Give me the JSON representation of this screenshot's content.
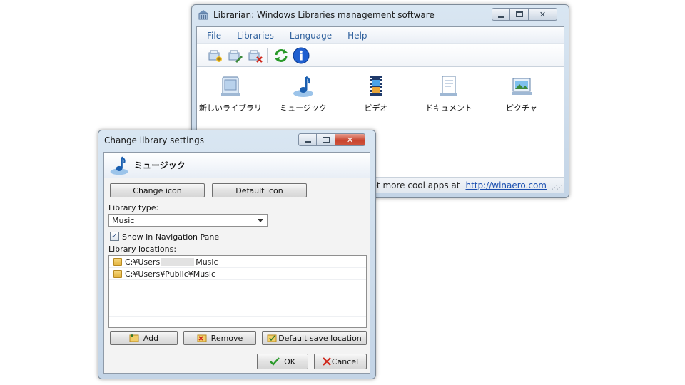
{
  "main_window": {
    "title": "Librarian: Windows Libraries management software",
    "menu": [
      "File",
      "Libraries",
      "Language",
      "Help"
    ],
    "toolbar_icons": [
      "new-library-icon",
      "edit-library-icon",
      "delete-library-icon",
      "refresh-icon",
      "info-icon"
    ],
    "libraries": [
      {
        "label": "新しいライブラリ",
        "icon": "new-library-icon"
      },
      {
        "label": "ミュージック",
        "icon": "music-note-icon"
      },
      {
        "label": "ビデオ",
        "icon": "film-icon"
      },
      {
        "label": "ドキュメント",
        "icon": "document-icon"
      },
      {
        "label": "ピクチャ",
        "icon": "picture-icon"
      }
    ],
    "status_text": "et more cool apps at",
    "status_link": "http://winaero.com"
  },
  "dialog": {
    "title": "Change library settings",
    "library_name": "ミュージック",
    "change_icon_label": "Change icon",
    "default_icon_label": "Default icon",
    "library_type_label": "Library type:",
    "library_type_value": "Music",
    "show_nav_label": "Show in Navigation Pane",
    "show_nav_checked": true,
    "locations_label": "Library locations:",
    "locations": [
      {
        "prefix": "C:¥Users",
        "suffix": "Music"
      },
      {
        "prefix": "C:¥Users¥Public¥Music",
        "suffix": ""
      }
    ],
    "add_label": "Add",
    "remove_label": "Remove",
    "default_save_label": "Default save location",
    "ok_label": "OK",
    "cancel_label": "Cancel"
  },
  "colors": {
    "link": "#1b4fb0",
    "menu_text": "#2d5f9c",
    "close_red": "#c8442e",
    "info_blue": "#1f5fd0",
    "refresh_green": "#2a9a2a"
  }
}
